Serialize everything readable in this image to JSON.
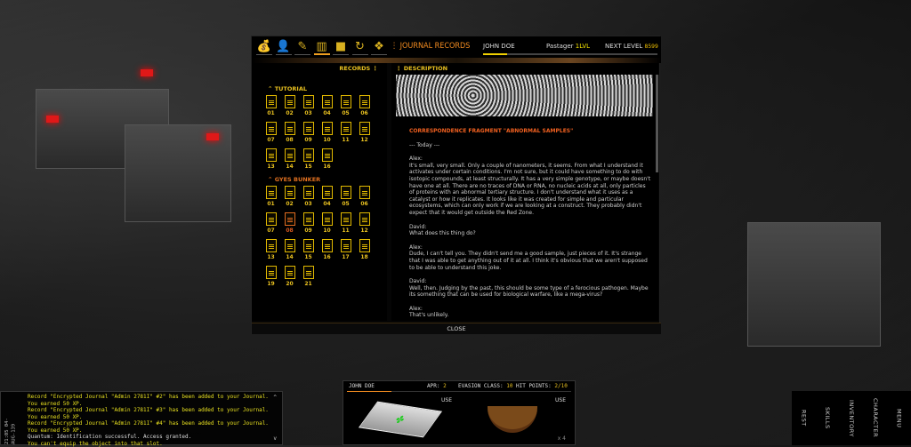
{
  "tabs": [
    {
      "icon": "money-bag-icon",
      "glyph": "💰"
    },
    {
      "icon": "character-icon",
      "glyph": "👤"
    },
    {
      "icon": "quest-icon",
      "glyph": "✎"
    },
    {
      "icon": "journal-icon",
      "glyph": "▥",
      "active": true
    },
    {
      "icon": "stop-icon",
      "glyph": "■"
    },
    {
      "icon": "history-icon",
      "glyph": "↻"
    },
    {
      "icon": "map-icon",
      "glyph": "❖"
    }
  ],
  "header": {
    "title": "JOURNAL RECORDS",
    "name": "JOHN DOE",
    "class_label": "Pastager",
    "level": "1LVL",
    "next_level_label": "NEXT LEVEL",
    "next_level_value": "8599",
    "xp_progress": 0.14
  },
  "records": {
    "heading": "RECORDS",
    "sections": [
      {
        "name": "TUTORIAL",
        "items": [
          "01",
          "02",
          "03",
          "04",
          "05",
          "06",
          "07",
          "08",
          "09",
          "10",
          "11",
          "12",
          "13",
          "14",
          "15",
          "16"
        ]
      },
      {
        "name": "GYES BUNKER",
        "items": [
          "01",
          "02",
          "03",
          "04",
          "05",
          "06",
          "07",
          "08",
          "09",
          "10",
          "11",
          "12",
          "13",
          "14",
          "15",
          "16",
          "17",
          "18",
          "19",
          "20",
          "21"
        ],
        "selected": "08"
      }
    ]
  },
  "description": {
    "heading": "DESCRIPTION",
    "title": "CORRESPONDENCE FRAGMENT \"ABNORMAL SAMPLES\"",
    "paragraphs": [
      "--- Today ---",
      "Alex:\nIt's small, very small. Only a couple of nanometers, it seems. From what I understand it activates under certain conditions. I'm not sure, but it could have something to do with isotopic compounds, at least structurally. It has a very simple genotype, or maybe doesn't have one at all. There are no traces of DNA or RNA, no nucleic acids at all, only particles of proteins with an abnormal tertiary structure. I don't understand what it uses as a catalyst or how it replicates. It looks like it was created for simple and particular ecosystems, which can only work if we are looking at a construct. They probably didn't expect that it would get outside the Red Zone.",
      "David:\nWhat does this thing do?",
      "Alex:\nDude, I can't tell you. They didn't send me a good sample, just pieces of it. It's strange that I was able to get anything out of it at all. I think it's obvious that we aren't supposed to be able to understand this joke.",
      "David:\nWell, then. Judging by the past, this should be some type of a ferocious pathogen. Maybe its something that can be used for biological warfare, like a mega-virus?",
      "Alex:\nThat's unlikely."
    ]
  },
  "close_label": "CLOSE",
  "log": {
    "clock": "21:05 04-AUG-139",
    "lines": [
      {
        "text": "Record \"Encrypted Journal \"Admin 2781I\" #2\" has been added to your Journal.",
        "c": "y"
      },
      {
        "text": "You earned 50 XP.",
        "c": "y"
      },
      {
        "text": "Record \"Encrypted Journal \"Admin 2781I\" #3\" has been added to your Journal.",
        "c": "y"
      },
      {
        "text": "You earned 50 XP.",
        "c": "y"
      },
      {
        "text": "Record \"Encrypted Journal \"Admin 2781I\" #4\" has been added to your Journal.",
        "c": "y"
      },
      {
        "text": "You earned 50 XP.",
        "c": "y"
      },
      {
        "text": "Quantum: Identification successful. Access granted.",
        "c": "w"
      },
      {
        "text": "You can't equip the object into that slot.",
        "c": "y"
      }
    ]
  },
  "hotbar": {
    "name": "JOHN DOE",
    "apr_label": "APR:",
    "apr": "2",
    "evasion_label": "EVASION CLASS:",
    "evasion": "10",
    "hp_label": "HIT POINTS:",
    "hp": "2/10",
    "slots": [
      {
        "item": "data-terminal",
        "use": "USE"
      },
      {
        "item": "bananas",
        "use": "USE",
        "count": "x 4"
      }
    ]
  },
  "menu": [
    "REST",
    "SKILLS",
    "INVENTORY",
    "CHARACTER",
    "MENU"
  ],
  "colors": {
    "accent": "#f08a20",
    "yellow": "#e8c020"
  }
}
